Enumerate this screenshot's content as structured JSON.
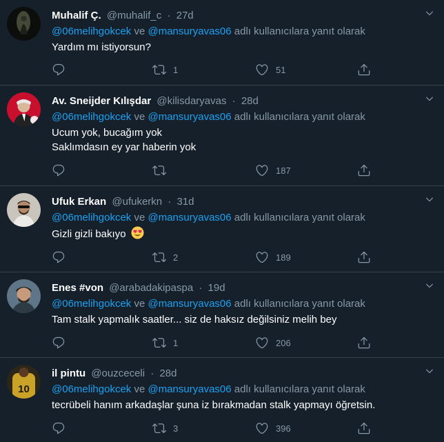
{
  "tweets": [
    {
      "name": "Muhalif Ç.",
      "handle": "@muhalif_c",
      "time": "27d",
      "mention1": "@06melihgokcek",
      "connector": "ve",
      "mention2": "@mansuryavas06",
      "reply_suffix": "adlı kullanıcılara yanıt olarak",
      "lines": [
        "Yardım mı istiyorsun?"
      ],
      "retweets": "1",
      "likes": "51"
    },
    {
      "name": "Av. Sneijder Kılışdar",
      "handle": "@kilisdaryavas",
      "time": "28d",
      "mention1": "@06melihgokcek",
      "connector": "ve",
      "mention2": "@mansuryavas06",
      "reply_suffix": "adlı kullanıcılara yanıt olarak",
      "lines": [
        "Ucum yok, bucağım yok",
        "Saklımdasın ey yar haberin yok"
      ],
      "retweets": "",
      "likes": "187"
    },
    {
      "name": "Ufuk Erkan",
      "handle": "@ufukerkn",
      "time": "31d",
      "mention1": "@06melihgokcek",
      "connector": "ve",
      "mention2": "@mansuryavas06",
      "reply_suffix": "adlı kullanıcılara yanıt olarak",
      "lines": [
        "Gizli gizli bakıyo"
      ],
      "emoji": "heart-eyes-emoji",
      "retweets": "2",
      "likes": "189"
    },
    {
      "name": "Enes #von",
      "handle": "@arabadakipaspa",
      "time": "19d",
      "mention1": "@06melihgokcek",
      "connector": "ve",
      "mention2": "@mansuryavas06",
      "reply_suffix": "adlı kullanıcılara yanıt olarak",
      "lines": [
        "Tam stalk yapmalık saatler... siz de haksız değilsiniz melih bey"
      ],
      "retweets": "1",
      "likes": "206"
    },
    {
      "name": "il pintu",
      "handle": "@ouzceceli",
      "time": "28d",
      "mention1": "@06melihgokcek",
      "connector": "ve",
      "mention2": "@mansuryavas06",
      "reply_suffix": "adlı kullanıcılara yanıt olarak",
      "lines": [
        "tecrübeli hanım arkadaşlar şuna iz bırakmadan stalk yapmayı öğretsin."
      ],
      "retweets": "3",
      "likes": "396"
    }
  ],
  "separator": "·",
  "colors": {
    "background": "#15202b",
    "link": "#1da1f2",
    "muted": "#8899a6",
    "border": "#38444d"
  },
  "icons": [
    "reply-icon",
    "retweet-icon",
    "like-icon",
    "share-icon",
    "caret-down-icon"
  ]
}
